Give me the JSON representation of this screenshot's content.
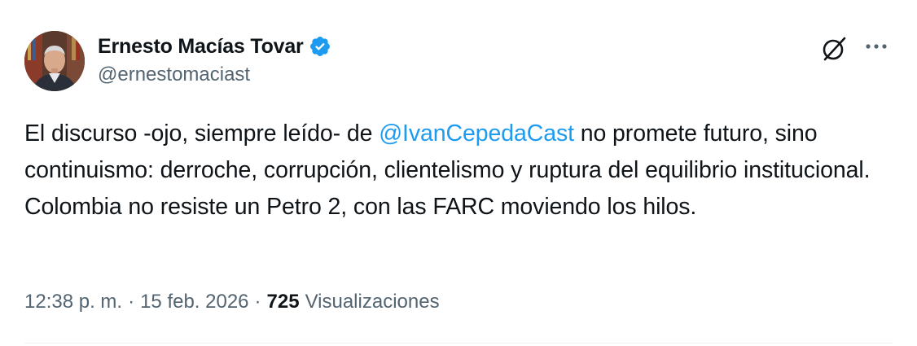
{
  "author": {
    "display_name": "Ernesto Macías Tovar",
    "handle": "@ernestomaciast",
    "verified": true,
    "verified_icon": "verified-badge-icon"
  },
  "actions": {
    "grok_icon": "grok-icon",
    "more_icon": "more-options-icon"
  },
  "tweet": {
    "text_before": "El discurso -ojo, siempre leído- de ",
    "mention": "@IvanCepedaCast",
    "text_after": " no promete futuro, sino continuismo: derroche, corrupción, clientelismo y ruptura del equilibrio institucional. Colombia no resiste un Petro 2, con las FARC moviendo los hilos."
  },
  "meta": {
    "time": "12:38 p. m.",
    "separator": "·",
    "date": "15 feb. 2026",
    "views_count": "725",
    "views_label": "Visualizaciones"
  },
  "colors": {
    "link": "#1d9bf0",
    "verified": "#1d9bf0",
    "text": "#0f1419",
    "secondary": "#536471",
    "divider": "#eff3f4"
  }
}
